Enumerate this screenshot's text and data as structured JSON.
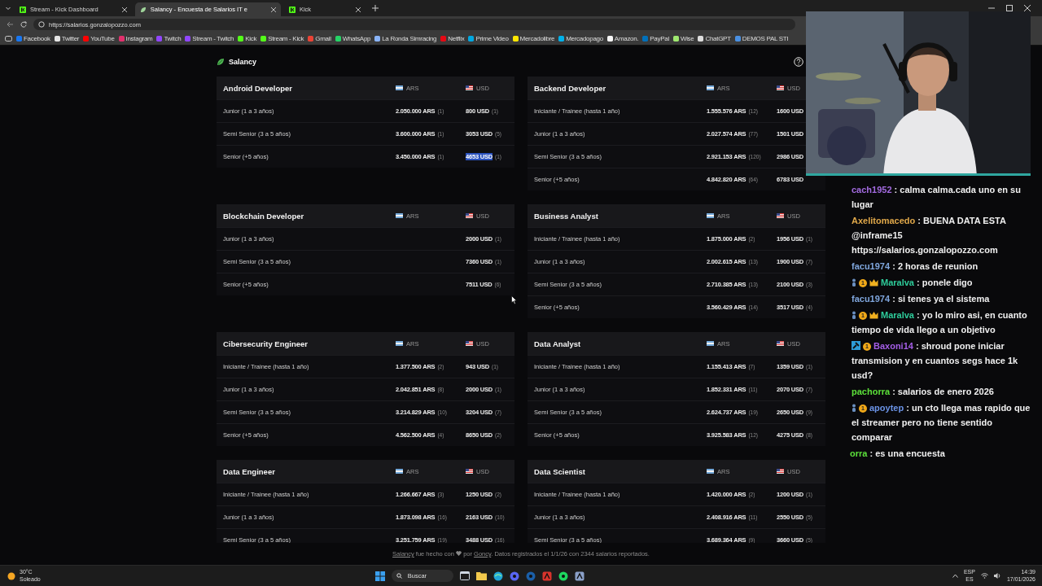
{
  "browser": {
    "tabs": [
      {
        "title": "Stream - Kick Dashboard",
        "selected": false
      },
      {
        "title": "Salancy - Encuesta de Salarios IT e",
        "selected": true
      },
      {
        "title": "Kick",
        "selected": false
      }
    ],
    "url": "https://salarios.gonzalopozzo.com",
    "bookmarks": [
      {
        "label": "Facebook",
        "color": "#1877f2"
      },
      {
        "label": "Twitter",
        "color": "#e6e6e6"
      },
      {
        "label": "YouTube",
        "color": "#ff0000"
      },
      {
        "label": "Instagram",
        "color": "#e1306c"
      },
      {
        "label": "Twitch",
        "color": "#9146ff"
      },
      {
        "label": "Stream - Twitch",
        "color": "#9147fe"
      },
      {
        "label": "Kick",
        "color": "#53fc18"
      },
      {
        "label": "Stream - Kick",
        "color": "#54fc19"
      },
      {
        "label": "Gmail",
        "color": "#ea4335"
      },
      {
        "label": "WhatsApp",
        "color": "#25d366"
      },
      {
        "label": "La Ronda Simracing",
        "color": "#8ab4f8"
      },
      {
        "label": "Netflix",
        "color": "#e50914"
      },
      {
        "label": "Prime Video",
        "color": "#00a8e1"
      },
      {
        "label": "Mercadolibre",
        "color": "#ffe600"
      },
      {
        "label": "Mercadopago",
        "color": "#00b1ea"
      },
      {
        "label": "Amazon.",
        "color": "#f5f5f5"
      },
      {
        "label": "PayPal",
        "color": "#0070ba"
      },
      {
        "label": "Wise",
        "color": "#9fe870"
      },
      {
        "label": "ChatGPT",
        "color": "#dddddd"
      },
      {
        "label": "DEMOS PAL STI",
        "color": "#4a90e2"
      }
    ]
  },
  "site": {
    "brand": "Salancy",
    "cards": [
      {
        "title": "Android Developer",
        "ars_label": "ARS",
        "usd_label": "USD",
        "rows": [
          {
            "level": "Junior (1 a 3 años)",
            "ars": "2.050.000 ARS",
            "ars_count": "(1)",
            "usd": "800 USD",
            "usd_count": "(1)",
            "usd_highlighted": false
          },
          {
            "level": "Semi Senior (3 a 5 años)",
            "ars": "3.600.000 ARS",
            "ars_count": "(1)",
            "usd": "3053 USD",
            "usd_count": "(5)",
            "usd_highlighted": false
          },
          {
            "level": "Senior (+5 años)",
            "ars": "3.450.000 ARS",
            "ars_count": "(1)",
            "usd": "4653 USD",
            "usd_count": "(1)",
            "usd_highlighted": true
          }
        ]
      },
      {
        "title": "Backend Developer",
        "ars_label": "ARS",
        "usd_label": "USD",
        "rows": [
          {
            "level": "Iniciante / Trainee (hasta 1 año)",
            "ars": "1.555.576 ARS",
            "ars_count": "(12)",
            "usd": "1600 USD",
            "usd_highlighted": false
          },
          {
            "level": "Junior (1 a 3 años)",
            "ars": "2.027.574 ARS",
            "ars_count": "(77)",
            "usd": "1501 USD",
            "usd_highlighted": false
          },
          {
            "level": "Semi Senior (3 a 5 años)",
            "ars": "2.921.153 ARS",
            "ars_count": "(120)",
            "usd": "2986 USD",
            "usd_highlighted": false
          },
          {
            "level": "Senior (+5 años)",
            "ars": "4.842.820 ARS",
            "ars_count": "(64)",
            "usd": "6783 USD",
            "usd_highlighted": false
          }
        ]
      },
      {
        "title": "Blockchain Developer",
        "ars_label": "ARS",
        "usd_label": "USD",
        "rows": [
          {
            "level": "Junior (1 a 3 años)",
            "usd": "2000 USD",
            "usd_count": "(1)",
            "usd_highlighted": false
          },
          {
            "level": "Semi Senior (3 a 5 años)",
            "usd": "7360 USD",
            "usd_count": "(1)",
            "usd_highlighted": false
          },
          {
            "level": "Senior (+5 años)",
            "usd": "7511 USD",
            "usd_count": "(6)",
            "usd_highlighted": false
          }
        ]
      },
      {
        "title": "Business Analyst",
        "ars_label": "ARS",
        "usd_label": "USD",
        "rows": [
          {
            "level": "Iniciante / Trainee (hasta 1 año)",
            "ars": "1.875.000 ARS",
            "ars_count": "(2)",
            "usd": "1956 USD",
            "usd_count": "(1)",
            "usd_highlighted": false
          },
          {
            "level": "Junior (1 a 3 años)",
            "ars": "2.002.615 ARS",
            "ars_count": "(13)",
            "usd": "1900 USD",
            "usd_count": "(7)",
            "usd_highlighted": false
          },
          {
            "level": "Semi Senior (3 a 5 años)",
            "ars": "2.710.385 ARS",
            "ars_count": "(13)",
            "usd": "2100 USD",
            "usd_count": "(3)",
            "usd_highlighted": false
          },
          {
            "level": "Senior (+5 años)",
            "ars": "3.560.429 ARS",
            "ars_count": "(14)",
            "usd": "3517 USD",
            "usd_count": "(4)",
            "usd_highlighted": false
          }
        ]
      },
      {
        "title": "Cibersecurity Engineer",
        "ars_label": "ARS",
        "usd_label": "USD",
        "rows": [
          {
            "level": "Iniciante / Trainee (hasta 1 año)",
            "ars": "1.377.500 ARS",
            "ars_count": "(2)",
            "usd": "943 USD",
            "usd_count": "(1)",
            "usd_highlighted": false
          },
          {
            "level": "Junior (1 a 3 años)",
            "ars": "2.042.851 ARS",
            "ars_count": "(8)",
            "usd": "2000 USD",
            "usd_count": "(1)",
            "usd_highlighted": false
          },
          {
            "level": "Semi Senior (3 a 5 años)",
            "ars": "3.214.829 ARS",
            "ars_count": "(10)",
            "usd": "3204 USD",
            "usd_count": "(7)",
            "usd_highlighted": false
          },
          {
            "level": "Senior (+5 años)",
            "ars": "4.562.500 ARS",
            "ars_count": "(4)",
            "usd": "8650 USD",
            "usd_count": "(2)",
            "usd_highlighted": false
          }
        ]
      },
      {
        "title": "Data Analyst",
        "ars_label": "ARS",
        "usd_label": "USD",
        "rows": [
          {
            "level": "Iniciante / Trainee (hasta 1 año)",
            "ars": "1.155.413 ARS",
            "ars_count": "(7)",
            "usd": "1359 USD",
            "usd_count": "(1)",
            "usd_highlighted": false
          },
          {
            "level": "Junior (1 a 3 años)",
            "ars": "1.852.331 ARS",
            "ars_count": "(11)",
            "usd": "2070 USD",
            "usd_count": "(7)",
            "usd_highlighted": false
          },
          {
            "level": "Semi Senior (3 a 5 años)",
            "ars": "2.624.737 ARS",
            "ars_count": "(19)",
            "usd": "2650 USD",
            "usd_count": "(9)",
            "usd_highlighted": false
          },
          {
            "level": "Senior (+5 años)",
            "ars": "3.925.583 ARS",
            "ars_count": "(12)",
            "usd": "4275 USD",
            "usd_count": "(8)",
            "usd_highlighted": false
          }
        ]
      },
      {
        "title": "Data Engineer",
        "ars_label": "ARS",
        "usd_label": "USD",
        "rows": [
          {
            "level": "Iniciante / Trainee (hasta 1 año)",
            "ars": "1.266.667 ARS",
            "ars_count": "(3)",
            "usd": "1250 USD",
            "usd_count": "(2)",
            "usd_highlighted": false
          },
          {
            "level": "Junior (1 a 3 años)",
            "ars": "1.873.098 ARS",
            "ars_count": "(16)",
            "usd": "2163 USD",
            "usd_count": "(10)",
            "usd_highlighted": false
          },
          {
            "level": "Semi Senior (3 a 5 años)",
            "ars": "3.251.759 ARS",
            "ars_count": "(19)",
            "usd": "3488 USD",
            "usd_count": "(16)",
            "usd_highlighted": false
          }
        ]
      },
      {
        "title": "Data Scientist",
        "ars_label": "ARS",
        "usd_label": "USD",
        "rows": [
          {
            "level": "Iniciante / Trainee (hasta 1 año)",
            "ars": "1.420.000 ARS",
            "ars_count": "(2)",
            "usd": "1200 USD",
            "usd_count": "(1)",
            "usd_highlighted": false
          },
          {
            "level": "Junior (1 a 3 años)",
            "ars": "2.408.916 ARS",
            "ars_count": "(11)",
            "usd": "2550 USD",
            "usd_count": "(5)",
            "usd_highlighted": false
          },
          {
            "level": "Semi Senior (3 a 5 años)",
            "ars": "3.689.364 ARS",
            "ars_count": "(9)",
            "usd": "3660 USD",
            "usd_count": "(5)",
            "usd_highlighted": false
          }
        ]
      }
    ],
    "footer": {
      "link_1": "Salancy",
      "text_1": "fue hecho con",
      "text_2": "por",
      "link_2": "Goncy",
      "text_3": ". Datos registrados el 1/1/26 con 2344 salarios reportados."
    }
  },
  "chat": {
    "messages": [
      {
        "user": "cach1952",
        "color": "#a36be0",
        "text": ": calma calma.cada uno en su lugar"
      },
      {
        "user": "Axelitomacedo",
        "color": "#e0a84a",
        "text": ": BUENA DATA ESTA @inframe15 https://salarios.gonzalopozzo.com"
      },
      {
        "user": "facu1974",
        "color": "#7fa6dc",
        "text": ": 2 horas de reunion"
      },
      {
        "user": "Maralva",
        "color": "#2ecc9a",
        "badges": [
          {
            "kind": "figure"
          },
          {
            "kind": "coin",
            "label": "1"
          },
          {
            "kind": "crown"
          }
        ],
        "text": ": ponele digo"
      },
      {
        "user": "facu1974",
        "color": "#7fa6dd",
        "text": ": si tenes ya el sistema"
      },
      {
        "user": "Maralva",
        "color": "#2ecc9b",
        "badges": [
          {
            "kind": "figure"
          },
          {
            "kind": "coin",
            "label": "1"
          },
          {
            "kind": "crown"
          }
        ],
        "text": ": yo lo miro asi, en cuanto tiempo de vida llego a un objetivo"
      },
      {
        "user": "Baxoni14",
        "color": "#a45ee6",
        "badges": [
          {
            "kind": "hammer"
          },
          {
            "kind": "coin",
            "label": "1"
          }
        ],
        "text": ": shroud pone iniciar transmision y en cuantos segs hace 1k usd?"
      },
      {
        "user": "pachorra",
        "color": "#5ce03a",
        "text": ": salarios de enero 2026"
      },
      {
        "user": "apoytep",
        "color": "#6b93e6",
        "badges": [
          {
            "kind": "figure"
          },
          {
            "kind": "coin",
            "label": "1"
          }
        ],
        "text": ": un cto llega mas rapido que el streamer pero no tiene sentido comparar"
      },
      {
        "user": "orra",
        "color": "#5ce03b",
        "text": ": es una encuesta"
      }
    ]
  },
  "taskbar": {
    "weather": {
      "temp": "30°C",
      "condition": "Soleado"
    },
    "search": {
      "placeholder": "Buscar"
    },
    "apps": [
      {
        "kind": "window",
        "color": "#cfd8e3"
      },
      {
        "kind": "folder",
        "color": "#f2c94c"
      },
      {
        "kind": "globe",
        "color": "#1fa5d8"
      },
      {
        "kind": "circle",
        "color": "#5865f2"
      },
      {
        "kind": "circle",
        "color": "#1b5fa8"
      },
      {
        "kind": "square",
        "color": "#d8342c"
      },
      {
        "kind": "circle",
        "color": "#1ed760"
      },
      {
        "kind": "square",
        "color": "#8aa0c8"
      }
    ],
    "language": "ESP",
    "layout": "ES",
    "time": "14:39",
    "date": "17/01/2026"
  }
}
